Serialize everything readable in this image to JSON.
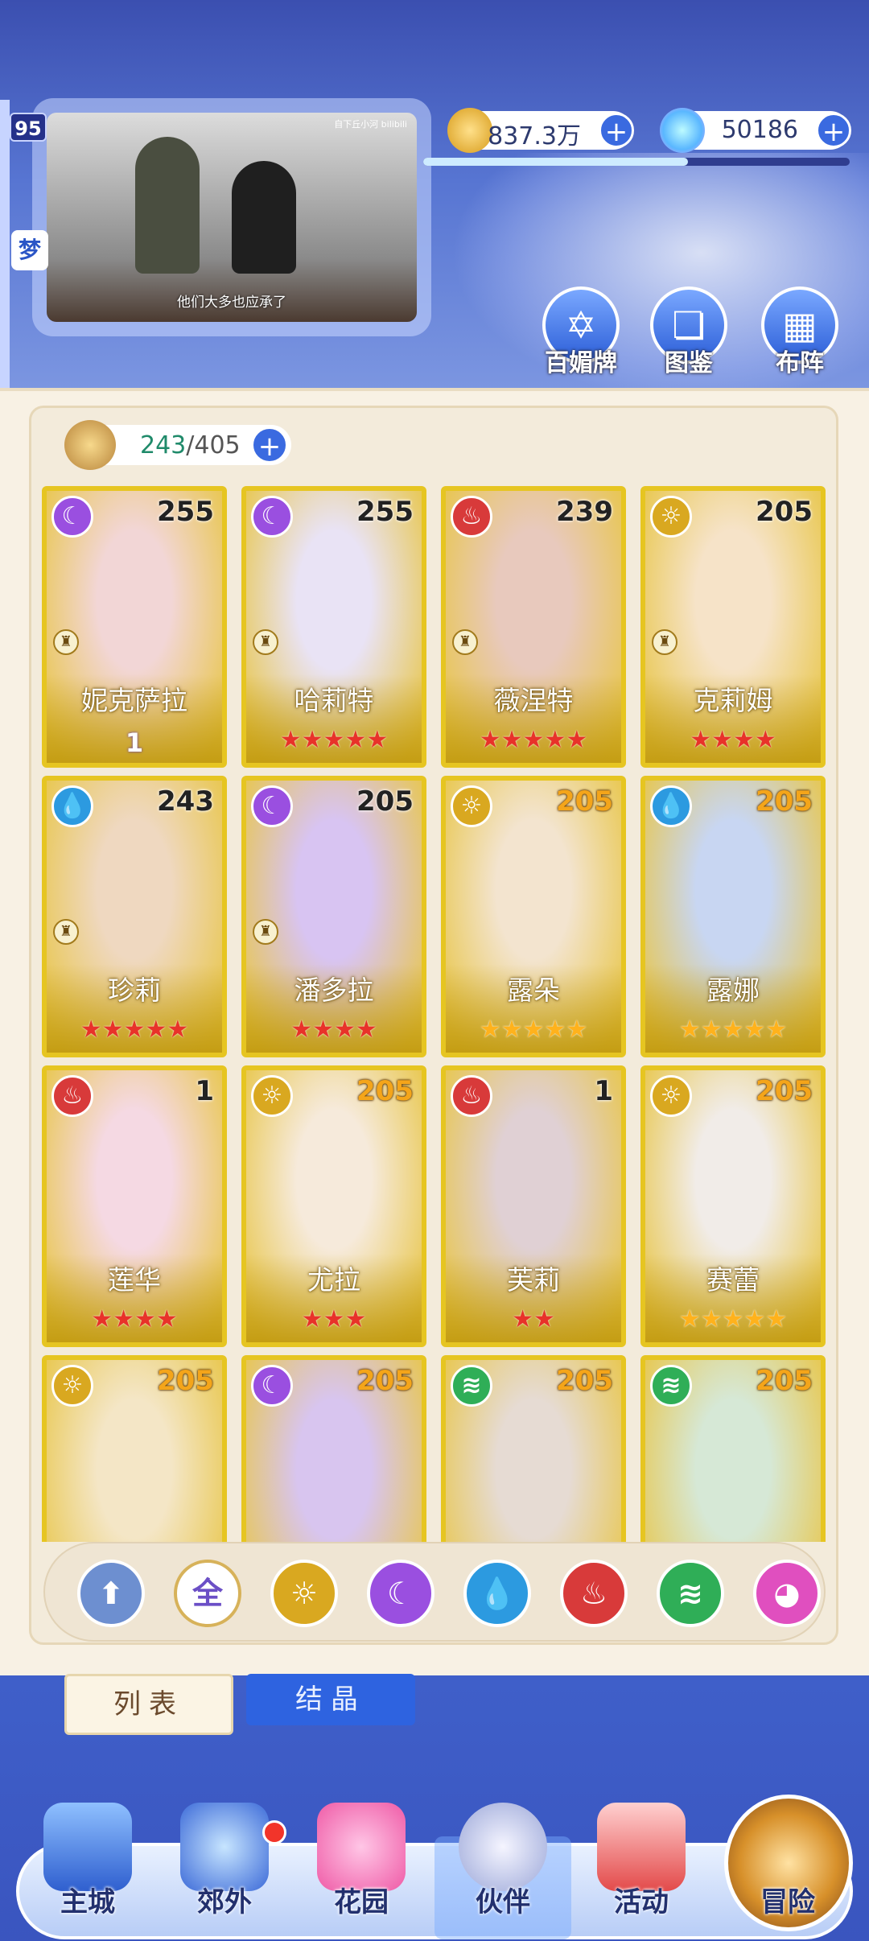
{
  "player": {
    "level": "95",
    "side_icon_label": "梦"
  },
  "video": {
    "caption": "他们大多也应承了",
    "watermark": "自下丘小河 bilibili"
  },
  "resources": {
    "gold": {
      "value": "837.3万",
      "plus": "+"
    },
    "gems": {
      "value": "50186",
      "plus": "+"
    }
  },
  "xp_progress": 0.62,
  "top_buttons": [
    {
      "label": "百媚牌",
      "icon": "star-card-icon"
    },
    {
      "label": "图鉴",
      "icon": "book-icon"
    },
    {
      "label": "布阵",
      "icon": "grid-icon"
    }
  ],
  "roster": {
    "current": "243",
    "separator": "/",
    "max": "405",
    "plus": "+"
  },
  "characters": [
    {
      "name": "妮克萨拉",
      "level": "255",
      "element": "moon",
      "stars": "",
      "badge": "1",
      "level_color": "dark"
    },
    {
      "name": "哈莉特",
      "level": "255",
      "element": "moon",
      "stars": "★★★★★",
      "badge": "",
      "level_color": "dark"
    },
    {
      "name": "薇涅特",
      "level": "239",
      "element": "fire",
      "stars": "★★★★★",
      "badge": "",
      "level_color": "dark"
    },
    {
      "name": "克莉姆",
      "level": "205",
      "element": "sun",
      "stars": "★★★★",
      "badge": "",
      "level_color": "dark"
    },
    {
      "name": "珍莉",
      "level": "243",
      "element": "water",
      "stars": "★★★★★",
      "badge": "",
      "level_color": "dark"
    },
    {
      "name": "潘多拉",
      "level": "205",
      "element": "moon",
      "stars": "★★★★",
      "badge": "",
      "level_color": "dark"
    },
    {
      "name": "露朵",
      "level": "205",
      "element": "sun",
      "stars": "★★★★★",
      "badge": "",
      "level_color": "gold",
      "star_color": "gold"
    },
    {
      "name": "露娜",
      "level": "205",
      "element": "water",
      "stars": "★★★★★",
      "badge": "",
      "level_color": "gold",
      "star_color": "gold"
    },
    {
      "name": "莲华",
      "level": "1",
      "element": "fire",
      "stars": "★★★★",
      "badge": "",
      "level_color": "dark"
    },
    {
      "name": "尤拉",
      "level": "205",
      "element": "sun",
      "stars": "★★★",
      "badge": "",
      "level_color": "gold"
    },
    {
      "name": "芙莉",
      "level": "1",
      "element": "fire",
      "stars": "★★",
      "badge": "",
      "level_color": "dark"
    },
    {
      "name": "赛蕾",
      "level": "205",
      "element": "sun",
      "stars": "★★★★★",
      "badge": "",
      "level_color": "gold",
      "star_color": "gold"
    },
    {
      "name": "",
      "level": "205",
      "element": "sun",
      "stars": "",
      "badge": "",
      "level_color": "gold"
    },
    {
      "name": "",
      "level": "205",
      "element": "moon",
      "stars": "",
      "badge": "",
      "level_color": "gold"
    },
    {
      "name": "",
      "level": "205",
      "element": "wind",
      "stars": "",
      "badge": "",
      "level_color": "gold"
    },
    {
      "name": "",
      "level": "205",
      "element": "wind",
      "stars": "",
      "badge": "",
      "level_color": "gold"
    }
  ],
  "filters": [
    {
      "name": "sort",
      "label": "",
      "color": "#6d8fd0"
    },
    {
      "name": "all",
      "label": "全",
      "color": "#ffffff"
    },
    {
      "name": "sun",
      "label": "",
      "color": "#d9a820"
    },
    {
      "name": "moon",
      "label": "",
      "color": "#9a4fe0"
    },
    {
      "name": "water",
      "label": "",
      "color": "#2c9ae0"
    },
    {
      "name": "fire",
      "label": "",
      "color": "#d83a3a"
    },
    {
      "name": "wind",
      "label": "",
      "color": "#2fae57"
    },
    {
      "name": "special",
      "label": "",
      "color": "#e04fbf"
    }
  ],
  "tabs": {
    "list": "列表",
    "crystal": "结晶"
  },
  "nav": [
    {
      "label": "主城",
      "icon": "castle-icon"
    },
    {
      "label": "郊外",
      "icon": "magic-circle-icon"
    },
    {
      "label": "花园",
      "icon": "heart-icon"
    },
    {
      "label": "伙伴",
      "icon": "partner-icon"
    },
    {
      "label": "活动",
      "icon": "gift-icon"
    },
    {
      "label": "冒险",
      "icon": "compass-icon"
    }
  ],
  "colors": {
    "accent": "#3a6ae0",
    "card_border": "#e6c521",
    "panel": "#f8f1e4"
  }
}
